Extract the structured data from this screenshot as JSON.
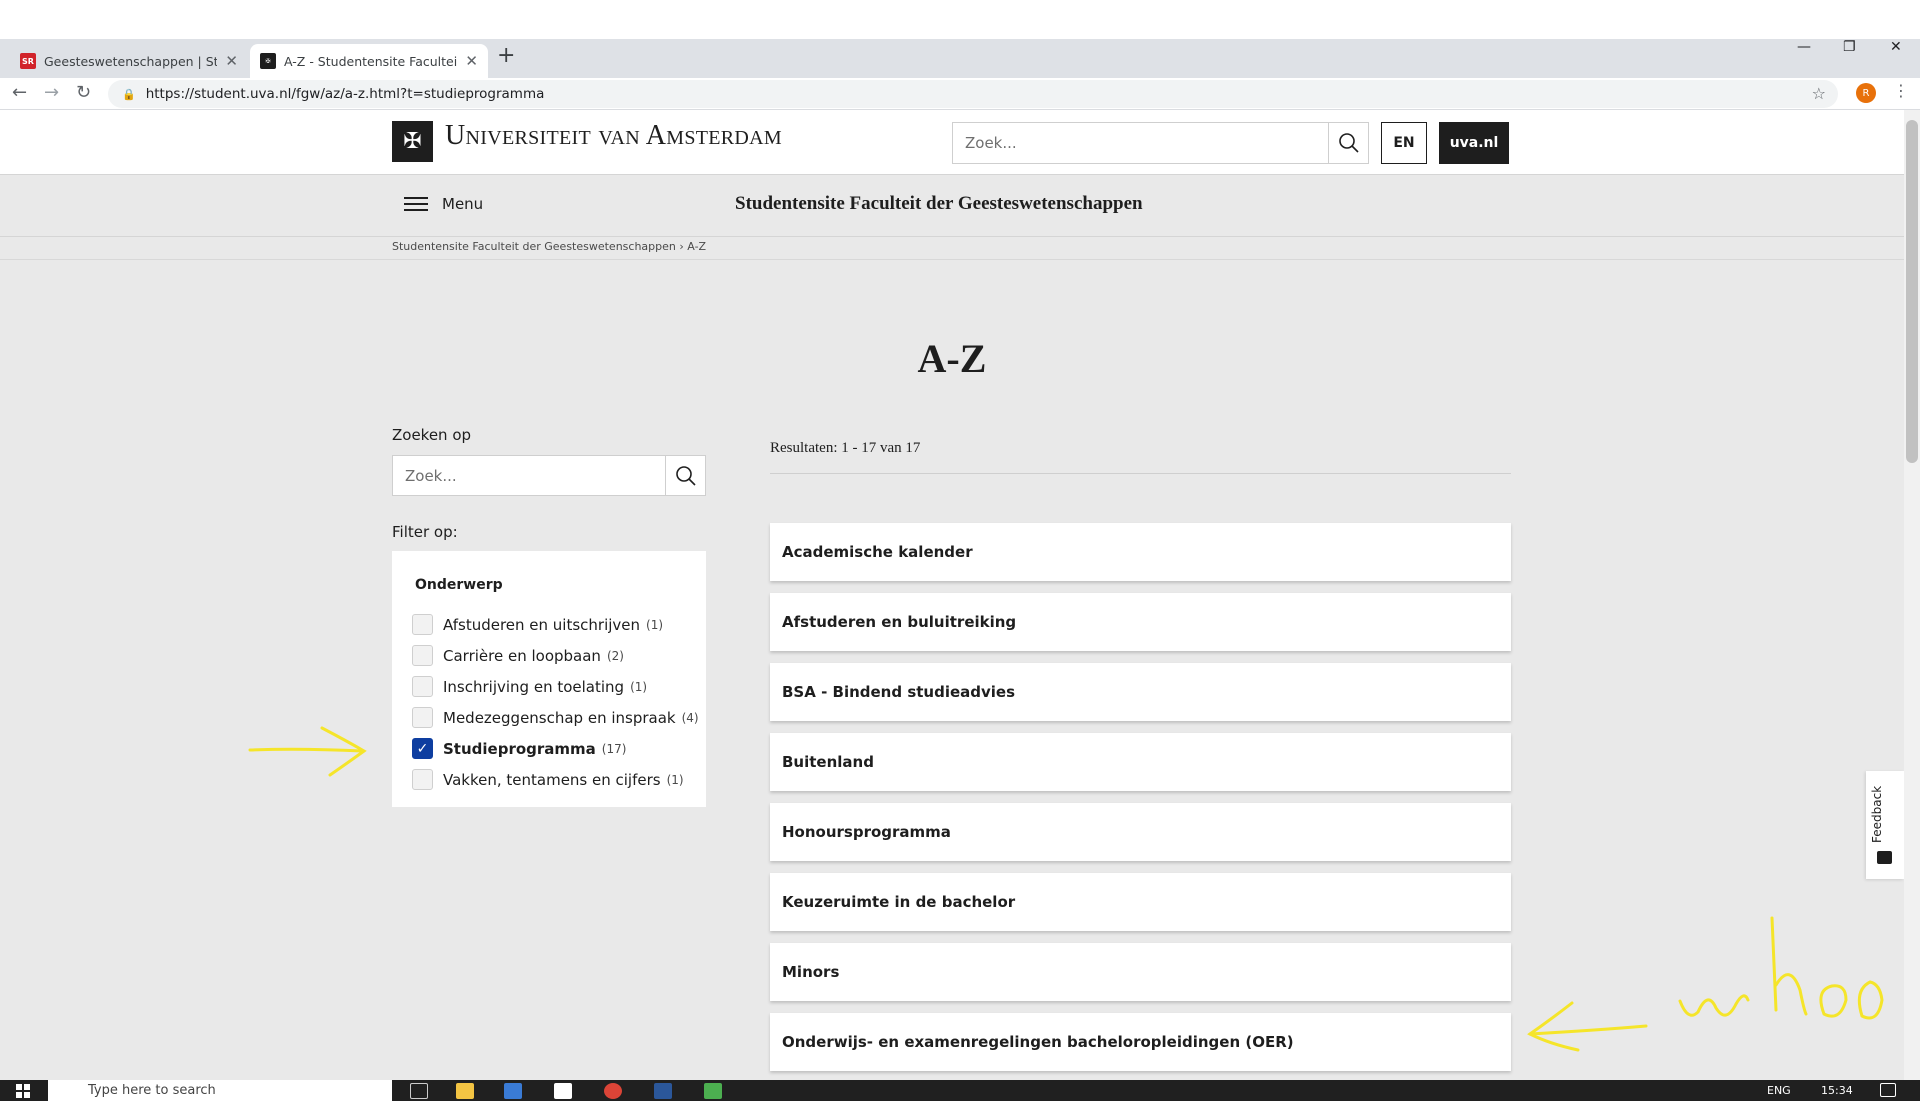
{
  "browser": {
    "tabs": [
      {
        "title": "Geesteswetenschappen | Student",
        "favicon": "SR"
      },
      {
        "title": "A-Z - Studentensite Faculteit der",
        "favicon": "UvA"
      }
    ],
    "url": "https://student.uva.nl/fgw/az/a-z.html?t=studieprogramma",
    "profile_initial": "R"
  },
  "header": {
    "logo_text": "Universiteit van Amsterdam",
    "search_placeholder": "Zoek...",
    "lang_button": "EN",
    "uva_button": "uva.nl"
  },
  "menubar": {
    "menu_label": "Menu",
    "site_title": "Studentensite Faculteit der Geesteswetenschappen"
  },
  "breadcrumb": {
    "items": [
      "Studentensite Faculteit der Geesteswetenschappen",
      "A-Z"
    ]
  },
  "page": {
    "title": "A-Z",
    "search_label": "Zoeken op",
    "search_placeholder": "Zoek...",
    "filter_label": "Filter op:",
    "filter": {
      "heading": "Onderwerp",
      "items": [
        {
          "label": "Afstuderen en uitschrijven",
          "count": "(1)",
          "checked": false
        },
        {
          "label": "Carrière en loopbaan",
          "count": "(2)",
          "checked": false
        },
        {
          "label": "Inschrijving en toelating",
          "count": "(1)",
          "checked": false
        },
        {
          "label": "Medezeggenschap en inspraak",
          "count": "(4)",
          "checked": false
        },
        {
          "label": "Studieprogramma",
          "count": "(17)",
          "checked": true
        },
        {
          "label": "Vakken, tentamens en cijfers",
          "count": "(1)",
          "checked": false
        }
      ]
    },
    "results_label": "Resultaten: 1 - 17 van 17",
    "results": [
      "Academische kalender",
      "Afstuderen en buluitreiking",
      "BSA - Bindend studieadvies",
      "Buitenland",
      "Honoursprogramma",
      "Keuzeruimte in de bachelor",
      "Minors",
      "Onderwijs- en examenregelingen bacheloropleidingen (OER)"
    ],
    "feedback_label": "Feedback"
  },
  "taskbar": {
    "search_placeholder": "Type here to search",
    "language": "ENG",
    "time": "15:34"
  },
  "colors": {
    "accent": "#0e3ea0",
    "annotation": "#f5e52a",
    "brand_dark": "#1e1e1e"
  }
}
